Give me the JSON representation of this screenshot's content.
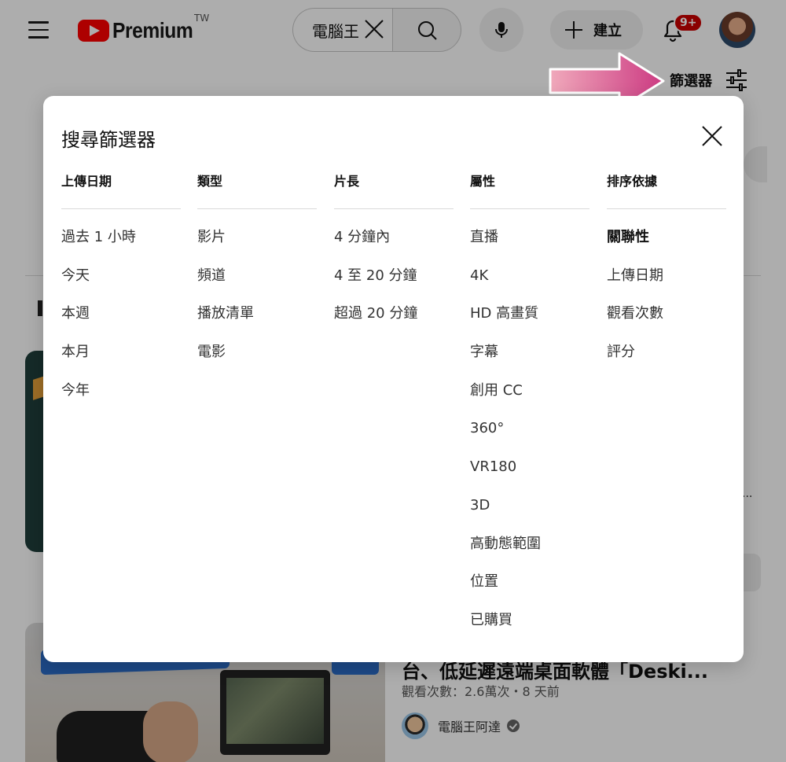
{
  "header": {
    "logo_text": "Premium",
    "logo_region": "TW",
    "search_value": "電腦王",
    "create_label": "建立",
    "notification_badge": "9+",
    "filter_label": "篩選器"
  },
  "background_video": {
    "title": "台、低延遲遠端桌面軟體「Deski...",
    "meta": "觀看次數：2.6萬次・8 天前",
    "channel": "電腦王阿達",
    "more_ellipsis": "..."
  },
  "dialog": {
    "title": "搜尋篩選器",
    "columns": [
      {
        "header": "上傳日期",
        "options": [
          "過去 1 小時",
          "今天",
          "本週",
          "本月",
          "今年"
        ]
      },
      {
        "header": "類型",
        "options": [
          "影片",
          "頻道",
          "播放清單",
          "電影"
        ]
      },
      {
        "header": "片長",
        "options": [
          "4 分鐘內",
          "4 至 20 分鐘",
          "超過 20 分鐘"
        ]
      },
      {
        "header": "屬性",
        "options": [
          "直播",
          "4K",
          "HD 高畫質",
          "字幕",
          "創用 CC",
          "360°",
          "VR180",
          "3D",
          "高動態範圍",
          "位置",
          "已購買"
        ]
      },
      {
        "header": "排序依據",
        "options": [
          "關聯性",
          "上傳日期",
          "觀看次數",
          "評分"
        ],
        "selected": "關聯性"
      }
    ]
  },
  "colors": {
    "accent_arrow": "#cc3a82",
    "youtube_red": "#ff0000",
    "badge_red": "#cc0000"
  }
}
